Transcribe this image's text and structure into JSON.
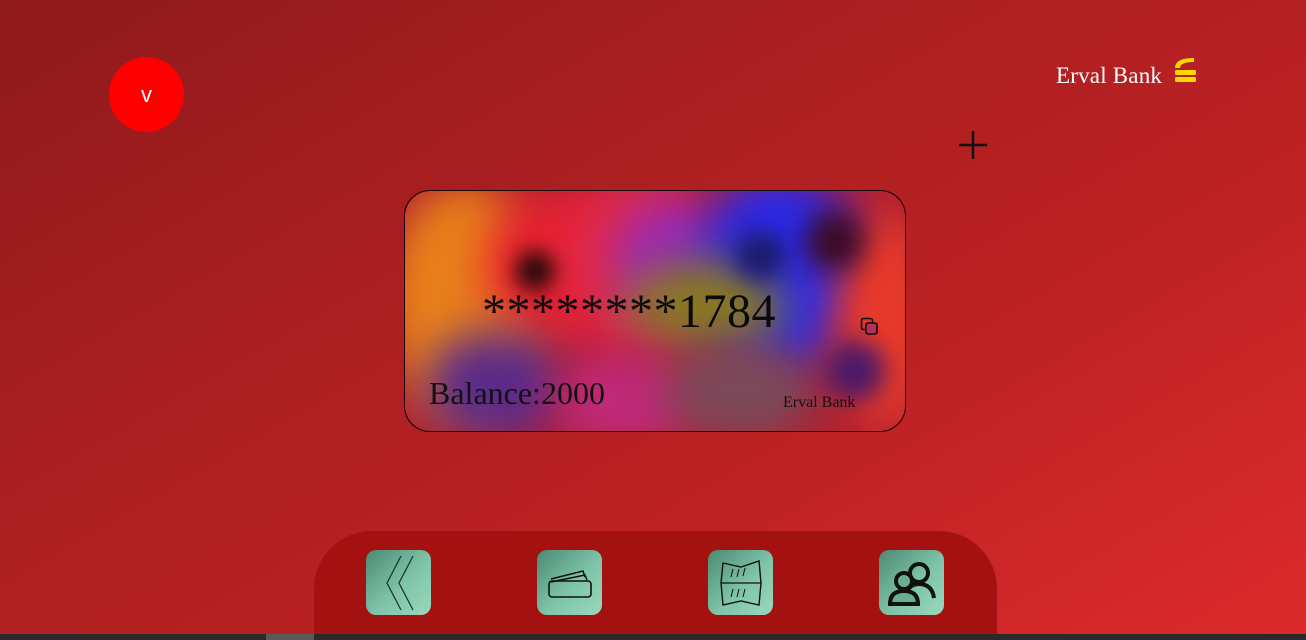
{
  "user": {
    "initial": "v"
  },
  "header": {
    "brand_name": "Erval Bank",
    "add_icon": "plus-icon",
    "logo_icon": "bank-logo-icon"
  },
  "card": {
    "number": "********1784",
    "balance_label": "Balance:",
    "balance_value": "2000",
    "bank_name": "Erval Bank",
    "copy_icon": "copy-icon"
  },
  "nav": {
    "items": [
      {
        "name": "back",
        "icon": "chevron-left-icon"
      },
      {
        "name": "cards",
        "icon": "cards-icon"
      },
      {
        "name": "transfers",
        "icon": "folded-map-icon"
      },
      {
        "name": "contacts",
        "icon": "users-icon"
      }
    ]
  },
  "colors": {
    "background": "#b82023",
    "avatar": "#ff0000",
    "logo": "#ffd700",
    "nav_bar": "#a31111",
    "nav_button": "#7ec4a8"
  }
}
